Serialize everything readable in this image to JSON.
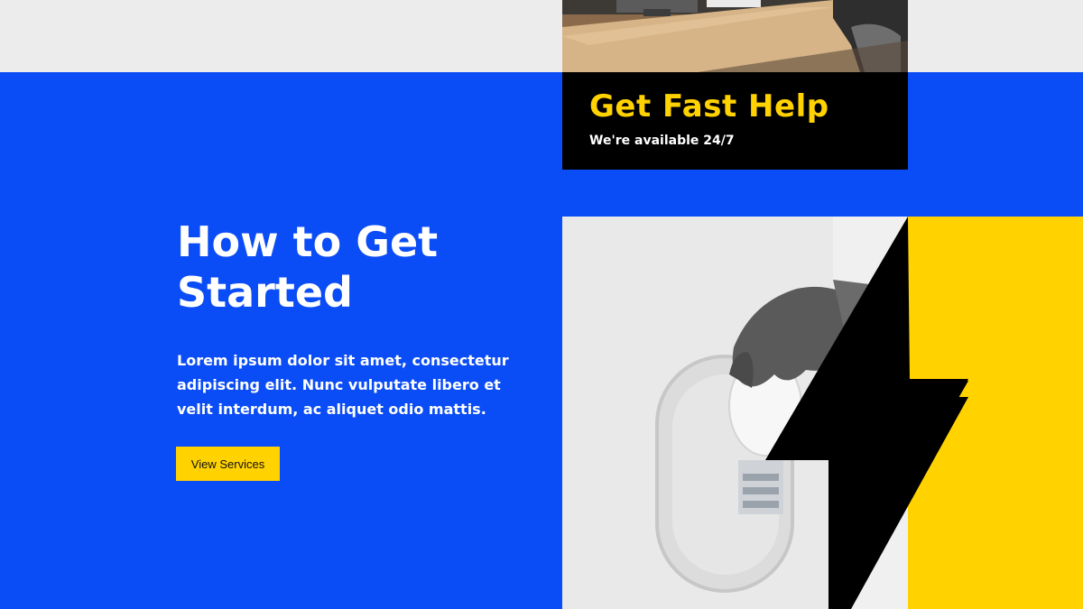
{
  "help_card": {
    "title": "Get Fast Help",
    "subtitle": "We're available 24/7"
  },
  "hero": {
    "headline_line1": "How to Get",
    "headline_line2": "Started",
    "body": "Lorem ipsum dolor sit amet, consectetur adipiscing elit. Nunc vulputate libero et velit interdum, ac aliquet odio mattis.",
    "cta_label": "View Services"
  },
  "colors": {
    "brand_blue": "#0a4cf5",
    "accent_yellow": "#ffd200",
    "black": "#000000",
    "light_gray": "#ececec"
  },
  "images": {
    "top": "desk-photo",
    "bottom": "light-bulb-photo-with-lightning-bolt"
  }
}
